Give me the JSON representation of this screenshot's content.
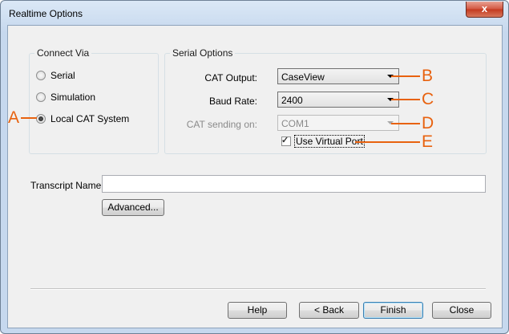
{
  "window": {
    "title": "Realtime Options",
    "close_glyph": "x"
  },
  "connect_via": {
    "title": "Connect Via",
    "options": [
      {
        "label": "Serial",
        "checked": false
      },
      {
        "label": "Simulation",
        "checked": false
      },
      {
        "label": "Local CAT System",
        "checked": true
      }
    ]
  },
  "serial_options": {
    "title": "Serial Options",
    "cat_output": {
      "label": "CAT Output:",
      "value": "CaseView"
    },
    "baud_rate": {
      "label": "Baud Rate:",
      "value": "2400"
    },
    "cat_sending_on": {
      "label": "CAT sending on:",
      "value": "COM1",
      "disabled": true
    },
    "use_virtual_port": {
      "label": "Use Virtual Port",
      "checked": true
    }
  },
  "transcript": {
    "label": "Transcript Name:",
    "value": ""
  },
  "advanced_button": "Advanced...",
  "footer": {
    "help": "Help",
    "back": "< Back",
    "finish": "Finish",
    "close": "Close"
  },
  "callouts": {
    "a": "A",
    "b": "B",
    "c": "C",
    "d": "D",
    "e": "E"
  },
  "colors": {
    "callout": "#e8620f",
    "title_bar": "#c6d8ee",
    "dialog_bg": "#f0f0f0",
    "close_button": "#c3391f"
  }
}
